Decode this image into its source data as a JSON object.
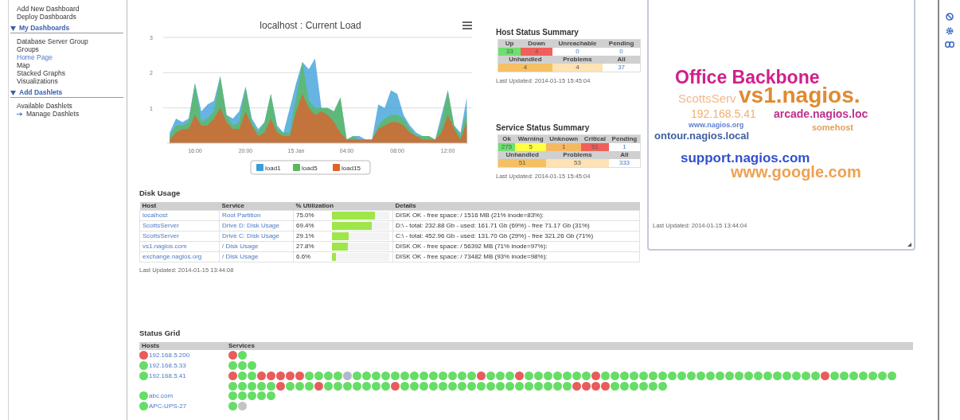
{
  "sidebar": {
    "items": [
      {
        "label": "Add New Dashboard",
        "selected": false
      },
      {
        "label": "Deploy Dashboards",
        "selected": false
      }
    ],
    "sections": [
      {
        "title": "My Dashboards",
        "expanded": true,
        "items": [
          {
            "label": "Database Server Group",
            "kind": "plain",
            "selected": false
          },
          {
            "label": "Groups",
            "kind": "plain",
            "selected": false
          },
          {
            "label": "Home Page",
            "kind": "plain",
            "selected": true
          },
          {
            "label": "Map",
            "kind": "plain",
            "selected": false
          },
          {
            "label": "Stacked Graphs",
            "kind": "plain",
            "selected": false
          },
          {
            "label": "Visualizations",
            "kind": "plain",
            "selected": false
          }
        ]
      },
      {
        "title": "Add Dashlets",
        "expanded": true,
        "items": [
          {
            "label": "Available Dashlets",
            "kind": "plain",
            "selected": false
          },
          {
            "label": "Manage Dashlets",
            "kind": "arrow",
            "selected": false
          }
        ]
      }
    ]
  },
  "chart": {
    "chart_data": {
      "type": "area",
      "title": "localhost : Current Load",
      "legend": "bottom",
      "grid": true,
      "x": [
        "2014-01-14T14:00",
        "2014-01-14T14:30",
        "2014-01-14T15:00",
        "2014-01-14T15:30",
        "2014-01-14T16:00",
        "2014-01-14T16:30",
        "2014-01-14T17:00",
        "2014-01-14T17:30",
        "2014-01-14T18:00",
        "2014-01-14T18:30",
        "2014-01-14T19:00",
        "2014-01-14T19:30",
        "2014-01-14T20:00",
        "2014-01-14T20:30",
        "2014-01-14T21:00",
        "2014-01-14T21:30",
        "2014-01-14T22:00",
        "2014-01-14T22:30",
        "2014-01-14T23:00",
        "2014-01-14T23:30",
        "2014-01-15T00:00",
        "2014-01-15T00:30",
        "2014-01-15T01:00",
        "2014-01-15T01:30",
        "2014-01-15T02:00",
        "2014-01-15T02:30",
        "2014-01-15T03:00",
        "2014-01-15T03:30",
        "2014-01-15T04:00",
        "2014-01-15T04:30",
        "2014-01-15T05:00",
        "2014-01-15T05:30",
        "2014-01-15T06:00",
        "2014-01-15T06:30",
        "2014-01-15T07:00",
        "2014-01-15T07:30",
        "2014-01-15T08:00",
        "2014-01-15T08:30",
        "2014-01-15T09:00",
        "2014-01-15T09:30",
        "2014-01-15T10:00",
        "2014-01-15T10:30",
        "2014-01-15T11:00",
        "2014-01-15T11:30",
        "2014-01-15T12:00",
        "2014-01-15T12:30",
        "2014-01-15T13:00",
        "2014-01-15T13:30"
      ],
      "series": [
        {
          "name": "load1",
          "color": "#3a9fd8",
          "values": [
            0.3,
            0.7,
            0.6,
            0.7,
            1.7,
            0.9,
            1.1,
            1.2,
            1.9,
            0.8,
            0.7,
            0.9,
            1.6,
            0.7,
            0.4,
            0.6,
            1.4,
            0.5,
            0.3,
            1.0,
            1.7,
            2.3,
            2.1,
            2.4,
            1.0,
            1.0,
            0.9,
            1.3,
            0.1,
            0.2,
            0.2,
            0.1,
            0.1,
            1.1,
            1.0,
            1.5,
            1.4,
            0.8,
            0.5,
            0.3,
            0.2,
            0.2,
            0.1,
            0.8,
            1.5,
            0.5,
            0.3,
            1.3
          ]
        },
        {
          "name": "load5",
          "color": "#5cb85c",
          "values": [
            0.2,
            0.5,
            0.5,
            0.6,
            1.7,
            0.6,
            0.7,
            0.9,
            1.9,
            0.8,
            0.5,
            0.6,
            1.6,
            0.6,
            0.3,
            0.6,
            1.4,
            0.4,
            0.3,
            0.3,
            1.3,
            2.3,
            1.2,
            1.0,
            1.0,
            1.0,
            0.9,
            1.3,
            0.1,
            0.2,
            0.1,
            0.1,
            0.1,
            0.5,
            0.7,
            0.8,
            0.8,
            0.7,
            0.4,
            0.2,
            0.2,
            0.2,
            0.1,
            0.6,
            1.5,
            0.5,
            0.2,
            0.9
          ]
        },
        {
          "name": "load15",
          "color": "#e0622a",
          "values": [
            0.1,
            0.3,
            0.4,
            0.4,
            0.8,
            0.5,
            0.5,
            0.7,
            1.0,
            0.6,
            0.4,
            0.4,
            0.9,
            0.5,
            0.2,
            0.3,
            0.7,
            0.3,
            0.2,
            0.2,
            0.9,
            1.4,
            1.0,
            0.8,
            0.9,
            0.8,
            0.6,
            0.3,
            0.1,
            0.1,
            0.1,
            0.1,
            0.1,
            0.4,
            0.5,
            0.6,
            0.6,
            0.5,
            0.3,
            0.2,
            0.1,
            0.1,
            0.1,
            0.3,
            0.8,
            0.4,
            0.1,
            0.6
          ]
        }
      ],
      "xlim": [
        "2014-01-14T13:48",
        "2014-01-15T13:36"
      ],
      "ylim": [
        0,
        3
      ],
      "xticks": [
        {
          "value": "2014-01-14T16:00",
          "label": "16:00"
        },
        {
          "value": "2014-01-14T20:00",
          "label": "20:00"
        },
        {
          "value": "2014-01-15T00:00",
          "label": "15 Jan"
        },
        {
          "value": "2014-01-15T04:00",
          "label": "04:00"
        },
        {
          "value": "2014-01-15T08:00",
          "label": "08:00"
        },
        {
          "value": "2014-01-15T12:00",
          "label": "12:00"
        }
      ],
      "yticks": [
        1,
        2,
        3
      ]
    }
  },
  "host_status_summary": {
    "title": "Host Status Summary",
    "rows": [
      {
        "kind": "header",
        "cells": [
          {
            "text": "Up"
          },
          {
            "text": "Down"
          },
          {
            "text": "Unreachable"
          },
          {
            "text": "Pending"
          }
        ]
      },
      {
        "kind": "values",
        "cells": [
          {
            "text": "33",
            "color": "#6fe06f"
          },
          {
            "text": "4",
            "color": "#f0605a"
          },
          {
            "text": "0",
            "color": "#ffffff"
          },
          {
            "text": "0",
            "color": "#ffffff"
          }
        ]
      },
      {
        "kind": "header",
        "cells": [
          {
            "text": "Unhandled"
          },
          {
            "text": "Problems"
          },
          {
            "text": "All"
          }
        ]
      },
      {
        "kind": "values",
        "cells": [
          {
            "text": "4",
            "color": "#f5c062"
          },
          {
            "text": "4",
            "color": "#fde2b4"
          },
          {
            "text": "37",
            "color": "#ffffff"
          }
        ]
      }
    ],
    "last_updated": "Last Updated: 2014-01-15 15:45:04"
  },
  "service_status_summary": {
    "title": "Service Status Summary",
    "rows": [
      {
        "kind": "header",
        "cells": [
          {
            "text": "Ok"
          },
          {
            "text": "Warning"
          },
          {
            "text": "Unknown"
          },
          {
            "text": "Critical"
          },
          {
            "text": "Pending"
          }
        ]
      },
      {
        "kind": "values",
        "cells": [
          {
            "text": "275",
            "color": "#6fe06f"
          },
          {
            "text": "5",
            "color": "#ffff44"
          },
          {
            "text": "1",
            "color": "#f5b862"
          },
          {
            "text": "51",
            "color": "#f0605a"
          },
          {
            "text": "1",
            "color": "#ffffff"
          }
        ]
      },
      {
        "kind": "header",
        "cells": [
          {
            "text": "Unhandled"
          },
          {
            "text": "Problems"
          },
          {
            "text": "All"
          }
        ]
      },
      {
        "kind": "values",
        "cells": [
          {
            "text": "51",
            "color": "#f5c062"
          },
          {
            "text": "53",
            "color": "#fde2b4"
          },
          {
            "text": "333",
            "color": "#ffffff"
          }
        ]
      }
    ],
    "last_updated": "Last Updated: 2014-01-15 15:45:04"
  },
  "disk_usage": {
    "title": "Disk Usage",
    "columns": [
      "Host",
      "Service",
      "% Utilization",
      "Details"
    ],
    "rows": [
      {
        "host": "localhost",
        "service": "Root Partition",
        "utilization": "75.0%",
        "level": 0.75,
        "details": "DISK OK - free space: / 1516 MB (21% inode=83%):"
      },
      {
        "host": "ScottsServer",
        "service": "Drive D: Disk Usage",
        "utilization": "69.4%",
        "level": 0.694,
        "details": "D:\\ - total: 232.88 Gb - used: 161.71 Gb (69%) - free 71.17 Gb (31%)"
      },
      {
        "host": "ScottsServer",
        "service": "Drive C: Disk Usage",
        "utilization": "29.1%",
        "level": 0.291,
        "details": "C:\\ - total: 452.96 Gb - used: 131.70 Gb (29%) - free 321.26 Gb (71%)"
      },
      {
        "host": "vs1.nagios.com",
        "service": "/ Disk Usage",
        "utilization": "27.8%",
        "level": 0.278,
        "details": "DISK OK - free space: / 56392 MB (71% inode=97%):"
      },
      {
        "host": "exchange.nagios.org",
        "service": "/ Disk Usage",
        "utilization": "6.6%",
        "level": 0.066,
        "details": "DISK OK - free space: / 73482 MB (93% inode=98%):"
      }
    ],
    "last_updated": "Last Updated: 2014-01-15 13:44:08"
  },
  "word_cloud": {
    "words": [
      {
        "text": "Office Backbone",
        "color": "#d0208a"
      },
      {
        "text": "ScottsServ",
        "color": "#f0b888"
      },
      {
        "text": "vs1.nagios.",
        "color": "#e08a30"
      },
      {
        "text": "192.168.5.41",
        "color": "#f0b070"
      },
      {
        "text": "arcade.nagios.loc",
        "color": "#c0308a"
      },
      {
        "text": "www.nagios.org",
        "color": "#6080d0"
      },
      {
        "text": "somehost",
        "color": "#e0a060"
      },
      {
        "text": "ontour.nagios.local",
        "color": "#4060a0"
      },
      {
        "text": "support.nagios.com",
        "color": "#3050d0"
      },
      {
        "text": "www.google.com",
        "color": "#f0a050"
      }
    ],
    "last_updated": "Last Updated: 2014-01-15 13:44:04"
  },
  "status_grid": {
    "title": "Status Grid",
    "columns": [
      "Hosts",
      "Services"
    ],
    "rows": [
      {
        "host": "192.168.5.200",
        "color": "#e85c5c",
        "services": [
          {
            "color": "#e85c5c"
          },
          {
            "color": "#66dd66"
          }
        ]
      },
      {
        "host": "192.168.5.33",
        "color": "#66dd66",
        "services": [
          {
            "color": "#66dd66"
          },
          {
            "color": "#66dd66"
          },
          {
            "color": "#66dd66"
          }
        ]
      },
      {
        "host": "192.168.5.41",
        "color": "#66dd66",
        "services": [
          {
            "color": "#e85c5c"
          },
          {
            "color": "#66dd66"
          },
          {
            "color": "#66dd66"
          },
          {
            "color": "#e85c5c"
          },
          {
            "color": "#e85c5c"
          },
          {
            "color": "#e85c5c"
          },
          {
            "color": "#e85c5c"
          },
          {
            "color": "#e85c5c"
          },
          {
            "color": "#66dd66"
          },
          {
            "color": "#66dd66"
          },
          {
            "color": "#66dd66"
          },
          {
            "color": "#66dd66"
          },
          {
            "color": "#b4b8cc"
          },
          {
            "color": "#66dd66"
          },
          {
            "color": "#66dd66"
          },
          {
            "color": "#66dd66"
          },
          {
            "color": "#66dd66"
          },
          {
            "color": "#66dd66"
          },
          {
            "color": "#66dd66"
          },
          {
            "color": "#66dd66"
          },
          {
            "color": "#66dd66"
          },
          {
            "color": "#66dd66"
          },
          {
            "color": "#66dd66"
          },
          {
            "color": "#66dd66"
          },
          {
            "color": "#66dd66"
          },
          {
            "color": "#66dd66"
          },
          {
            "color": "#e85c5c"
          },
          {
            "color": "#66dd66"
          },
          {
            "color": "#66dd66"
          },
          {
            "color": "#66dd66"
          },
          {
            "color": "#e85c5c"
          },
          {
            "color": "#66dd66"
          },
          {
            "color": "#66dd66"
          },
          {
            "color": "#66dd66"
          },
          {
            "color": "#66dd66"
          },
          {
            "color": "#66dd66"
          },
          {
            "color": "#66dd66"
          },
          {
            "color": "#66dd66"
          },
          {
            "color": "#e85c5c"
          },
          {
            "color": "#66dd66"
          },
          {
            "color": "#66dd66"
          },
          {
            "color": "#66dd66"
          },
          {
            "color": "#66dd66"
          },
          {
            "color": "#66dd66"
          },
          {
            "color": "#66dd66"
          },
          {
            "color": "#66dd66"
          },
          {
            "color": "#66dd66"
          },
          {
            "color": "#66dd66"
          },
          {
            "color": "#66dd66"
          },
          {
            "color": "#66dd66"
          },
          {
            "color": "#66dd66"
          },
          {
            "color": "#66dd66"
          },
          {
            "color": "#66dd66"
          },
          {
            "color": "#66dd66"
          },
          {
            "color": "#66dd66"
          },
          {
            "color": "#66dd66"
          },
          {
            "color": "#66dd66"
          },
          {
            "color": "#66dd66"
          },
          {
            "color": "#66dd66"
          },
          {
            "color": "#66dd66"
          },
          {
            "color": "#66dd66"
          },
          {
            "color": "#66dd66"
          },
          {
            "color": "#e85c5c"
          },
          {
            "color": "#66dd66"
          },
          {
            "color": "#66dd66"
          },
          {
            "color": "#66dd66"
          },
          {
            "color": "#66dd66"
          },
          {
            "color": "#66dd66"
          },
          {
            "color": "#66dd66"
          },
          {
            "color": "#66dd66"
          },
          {
            "color": "#66dd66"
          },
          {
            "color": "#66dd66"
          },
          {
            "color": "#66dd66"
          },
          {
            "color": "#66dd66"
          },
          {
            "color": "#66dd66"
          },
          {
            "color": "#e85c5c"
          },
          {
            "color": "#66dd66"
          },
          {
            "color": "#66dd66"
          },
          {
            "color": "#66dd66"
          },
          {
            "color": "#e85c5c"
          },
          {
            "color": "#66dd66"
          },
          {
            "color": "#66dd66"
          },
          {
            "color": "#66dd66"
          },
          {
            "color": "#66dd66"
          },
          {
            "color": "#66dd66"
          },
          {
            "color": "#66dd66"
          },
          {
            "color": "#66dd66"
          },
          {
            "color": "#e85c5c"
          },
          {
            "color": "#66dd66"
          },
          {
            "color": "#66dd66"
          },
          {
            "color": "#66dd66"
          },
          {
            "color": "#66dd66"
          },
          {
            "color": "#66dd66"
          },
          {
            "color": "#66dd66"
          },
          {
            "color": "#66dd66"
          },
          {
            "color": "#66dd66"
          },
          {
            "color": "#66dd66"
          },
          {
            "color": "#66dd66"
          },
          {
            "color": "#66dd66"
          },
          {
            "color": "#66dd66"
          },
          {
            "color": "#66dd66"
          },
          {
            "color": "#66dd66"
          },
          {
            "color": "#66dd66"
          },
          {
            "color": "#66dd66"
          },
          {
            "color": "#66dd66"
          },
          {
            "color": "#66dd66"
          },
          {
            "color": "#e85c5c"
          },
          {
            "color": "#e85c5c"
          },
          {
            "color": "#e85c5c"
          },
          {
            "color": "#e85c5c"
          },
          {
            "color": "#66dd66"
          },
          {
            "color": "#66dd66"
          },
          {
            "color": "#66dd66"
          },
          {
            "color": "#66dd66"
          },
          {
            "color": "#66dd66"
          },
          {
            "color": "#66dd66"
          }
        ]
      },
      {
        "host": "abc.com",
        "color": "#66dd66",
        "services": [
          {
            "color": "#66dd66"
          },
          {
            "color": "#66dd66"
          },
          {
            "color": "#66dd66"
          },
          {
            "color": "#66dd66"
          },
          {
            "color": "#66dd66"
          }
        ]
      },
      {
        "host": "APC-UPS-27",
        "color": "#66dd66",
        "services": [
          {
            "color": "#66dd66"
          },
          {
            "color": "#c4c4c4"
          }
        ]
      }
    ]
  }
}
